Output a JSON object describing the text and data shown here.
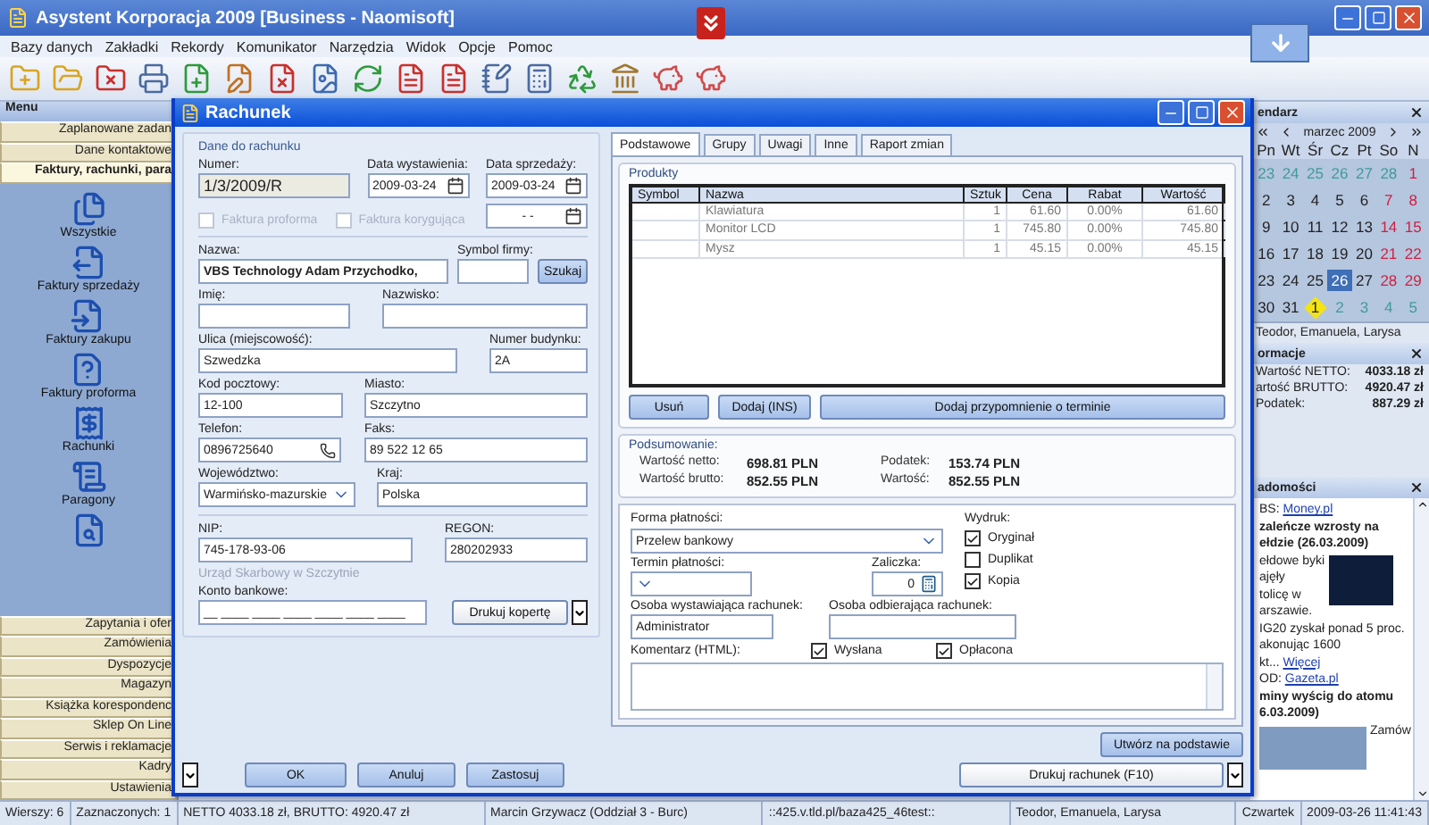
{
  "window": {
    "title": "Asystent Korporacja 2009  [Business - Naomisoft]"
  },
  "menu": [
    "Bazy danych",
    "Zakładki",
    "Rekordy",
    "Komunikator",
    "Narzędzia",
    "Widok",
    "Opcje",
    "Pomoc"
  ],
  "sidebar": {
    "title": "Menu",
    "groups_top": [
      {
        "label": "Zaplanowane zadan",
        "selected": false
      },
      {
        "label": "Dane kontaktowe",
        "selected": false
      },
      {
        "label": "Faktury, rachunki, para",
        "selected": true
      }
    ],
    "items": [
      {
        "label": "Wszystkie"
      },
      {
        "label": "Faktury sprzedaży"
      },
      {
        "label": "Faktury zakupu"
      },
      {
        "label": "Faktury proforma"
      },
      {
        "label": "Rachunki"
      },
      {
        "label": "Paragony"
      }
    ],
    "groups_bottom": [
      {
        "label": "Zapytania i ofer",
        "selected": false
      },
      {
        "label": "Zamówienia",
        "selected": false
      },
      {
        "label": "Dyspozycje",
        "selected": false
      },
      {
        "label": "Magazyn",
        "selected": false
      },
      {
        "label": "Książka korespondenc",
        "selected": false
      },
      {
        "label": "Sklep On Line",
        "selected": false
      },
      {
        "label": "Serwis i reklamacje",
        "selected": false
      },
      {
        "label": "Kadry",
        "selected": false
      },
      {
        "label": "Ustawienia",
        "selected": false
      }
    ]
  },
  "dialog": {
    "title": "Rachunek",
    "section_title": "Dane do rachunku",
    "number_row": [
      {
        "kind": "readonly",
        "label": "Numer:",
        "value": "1/3/2009/R"
      },
      {
        "kind": "date",
        "label": "Data wystawienia:",
        "value": "2009-03-24"
      },
      {
        "kind": "date",
        "label": "Data sprzedaży:",
        "value": "2009-03-24"
      }
    ],
    "doc_checks": [
      {
        "label": "Faktura proforma",
        "checked": false,
        "disabled": true
      },
      {
        "label": "Faktura korygująca",
        "checked": false,
        "disabled": true
      }
    ],
    "second_date": {
      "value": "- -"
    },
    "customer_rows": [
      [
        {
          "kind": "text",
          "label": "Nazwa:",
          "value": "VBS Technology Adam Przychodko,"
        },
        {
          "kind": "text",
          "label": "Symbol firmy:"
        },
        {
          "kind": "button",
          "label": "Szukaj"
        }
      ],
      [
        {
          "kind": "text",
          "label": "Imię:"
        },
        {
          "kind": "text",
          "label": "Nazwisko:"
        }
      ],
      [
        {
          "kind": "text",
          "label": "Ulica (miejscowość):",
          "value": "Szwedzka"
        },
        {
          "kind": "text",
          "label": "Numer budynku:",
          "value": "2A"
        }
      ],
      [
        {
          "kind": "text",
          "label": "Kod pocztowy:",
          "value": "12-100"
        },
        {
          "kind": "text",
          "label": "Miasto:",
          "value": "Szczytno"
        }
      ],
      [
        {
          "kind": "phone",
          "label": "Telefon:",
          "value": "0896725640"
        },
        {
          "kind": "text",
          "label": "Faks:",
          "value": "89 522 12 65"
        }
      ],
      [
        {
          "kind": "select",
          "label": "Województwo:",
          "value": "Warmińsko-mazurskie"
        },
        {
          "kind": "text",
          "label": "Kraj:",
          "value": "Polska"
        }
      ]
    ],
    "tax_row": [
      {
        "kind": "text",
        "label": "NIP:",
        "value": "745-178-93-06"
      },
      {
        "kind": "text",
        "label": "REGON:",
        "value": "280202933"
      }
    ],
    "tax_office": "Urząd Skarbowy w Szczytnie",
    "bank_row": [
      {
        "kind": "text",
        "label": "Konto bankowe:",
        "value": "__ ____ ____ ____ ____ ____ ____"
      },
      {
        "kind": "split",
        "label": "Drukuj kopertę"
      }
    ],
    "buttons": [
      "OK",
      "Anuluj",
      "Zastosuj"
    ],
    "tabs": [
      {
        "label": "Podstawowe",
        "selected": true
      },
      {
        "label": "Grupy",
        "selected": false
      },
      {
        "label": "Uwagi",
        "selected": false
      },
      {
        "label": "Inne",
        "selected": false
      },
      {
        "label": "Raport zmian",
        "selected": false
      }
    ],
    "products": {
      "title": "Produkty",
      "columns": [
        "Symbol",
        "Nazwa",
        "Sztuk",
        "Cena",
        "Rabat",
        "Wartość"
      ],
      "rows": [
        [
          "",
          "Klawiatura",
          "1",
          "61.60",
          "0.00%",
          "61.60"
        ],
        [
          "",
          "Monitor LCD",
          "1",
          "745.80",
          "0.00%",
          "745.80"
        ],
        [
          "",
          "Mysz",
          "1",
          "45.15",
          "0.00%",
          "45.15"
        ]
      ],
      "buttons": [
        "Usuń",
        "Dodaj (INS)",
        "Dodaj przypomnienie o terminie"
      ]
    },
    "summary": {
      "title": "Podsumowanie:",
      "items": [
        {
          "label": "Wartość netto:",
          "value": "698.81 PLN"
        },
        {
          "label": "Podatek:",
          "value": "153.74 PLN"
        },
        {
          "label": "Wartość brutto:",
          "value": "852.55 PLN"
        },
        {
          "label": "Wartość:",
          "value": "852.55 PLN"
        }
      ]
    },
    "payment": {
      "form": {
        "label": "Forma płatności:",
        "value": "Przelew bankowy"
      },
      "print": {
        "label": "Wydruk:",
        "options": [
          {
            "label": "Oryginał",
            "checked": true
          },
          {
            "label": "Duplikat",
            "checked": false
          },
          {
            "label": "Kopia",
            "checked": true
          }
        ]
      },
      "term": {
        "label": "Termin płatności:"
      },
      "advance": {
        "label": "Zaliczka:",
        "value": "0"
      },
      "issuer": {
        "label": "Osoba wystawiająca rachunek:",
        "value": "Administrator"
      },
      "receiver": {
        "label": "Osoba odbierająca rachunek:"
      },
      "comment": {
        "label": "Komentarz (HTML):"
      },
      "flags": [
        {
          "label": "Wysłana",
          "checked": true
        },
        {
          "label": "Opłacona",
          "checked": true
        }
      ]
    },
    "create_button": "Utwórz na podstawie",
    "print_button": "Drukuj rachunek (F10)"
  },
  "calendar": {
    "title": "endarz",
    "month": "marzec 2009",
    "weekdays": [
      "Pn",
      "Wt",
      "Śr",
      "Cz",
      "Pt",
      "So",
      "N"
    ],
    "weeks": [
      [
        {
          "day": "23",
          "kind": "other",
          "selected": false
        },
        {
          "day": "24",
          "kind": "other",
          "selected": false
        },
        {
          "day": "25",
          "kind": "other",
          "selected": false
        },
        {
          "day": "26",
          "kind": "other",
          "selected": false
        },
        {
          "day": "27",
          "kind": "other",
          "selected": false
        },
        {
          "day": "28",
          "kind": "other",
          "selected": false
        },
        {
          "day": "1",
          "kind": "weekend",
          "selected": false
        }
      ],
      [
        {
          "day": "2",
          "kind": "normal",
          "selected": false
        },
        {
          "day": "3",
          "kind": "normal",
          "selected": false
        },
        {
          "day": "4",
          "kind": "normal",
          "selected": false
        },
        {
          "day": "5",
          "kind": "normal",
          "selected": false
        },
        {
          "day": "6",
          "kind": "normal",
          "selected": false
        },
        {
          "day": "7",
          "kind": "weekend",
          "selected": false
        },
        {
          "day": "8",
          "kind": "weekend",
          "selected": false
        }
      ],
      [
        {
          "day": "9",
          "kind": "normal",
          "selected": false
        },
        {
          "day": "10",
          "kind": "normal",
          "selected": false
        },
        {
          "day": "11",
          "kind": "normal",
          "selected": false
        },
        {
          "day": "12",
          "kind": "normal",
          "selected": false
        },
        {
          "day": "13",
          "kind": "normal",
          "selected": false
        },
        {
          "day": "14",
          "kind": "weekend",
          "selected": false
        },
        {
          "day": "15",
          "kind": "weekend",
          "selected": false
        }
      ],
      [
        {
          "day": "16",
          "kind": "normal",
          "selected": false
        },
        {
          "day": "17",
          "kind": "normal",
          "selected": false
        },
        {
          "day": "18",
          "kind": "normal",
          "selected": false
        },
        {
          "day": "19",
          "kind": "normal",
          "selected": false
        },
        {
          "day": "20",
          "kind": "normal",
          "selected": false
        },
        {
          "day": "21",
          "kind": "weekend",
          "selected": false
        },
        {
          "day": "22",
          "kind": "weekend",
          "selected": false
        }
      ],
      [
        {
          "day": "23",
          "kind": "normal",
          "selected": false
        },
        {
          "day": "24",
          "kind": "normal",
          "selected": false
        },
        {
          "day": "25",
          "kind": "normal",
          "selected": false
        },
        {
          "day": "26",
          "kind": "normal",
          "selected": true
        },
        {
          "day": "27",
          "kind": "normal",
          "selected": false
        },
        {
          "day": "28",
          "kind": "weekend",
          "selected": false
        },
        {
          "day": "29",
          "kind": "weekend",
          "selected": false
        }
      ],
      [
        {
          "day": "30",
          "kind": "normal",
          "selected": false
        },
        {
          "day": "31",
          "kind": "normal",
          "selected": false
        },
        {
          "day": "1",
          "kind": "marked",
          "selected": false
        },
        {
          "day": "2",
          "kind": "other",
          "selected": false
        },
        {
          "day": "3",
          "kind": "other",
          "selected": false
        },
        {
          "day": "4",
          "kind": "other",
          "selected": false
        },
        {
          "day": "5",
          "kind": "other",
          "selected": false
        }
      ]
    ],
    "names": "Teodor, Emanuela, Larysa"
  },
  "info": {
    "title": "ormacje",
    "items": [
      {
        "label": "Wartość NETTO:",
        "value": "4033.18 zł"
      },
      {
        "label": "artość BRUTTO:",
        "value": "4920.47 zł"
      },
      {
        "label": "Podatek:",
        "value": "887.29 zł"
      }
    ]
  },
  "news": {
    "title": "adomości",
    "lines": [
      {
        "kind": "source",
        "prefix": "BS: ",
        "link": "Money.pl"
      },
      {
        "kind": "headline",
        "text": "zaleńcze wzrosty na"
      },
      {
        "kind": "headline",
        "text": "ełdzie (26.03.2009)"
      },
      {
        "kind": "photo_text",
        "text": "ełdowe byki"
      },
      {
        "kind": "photo_text",
        "text": "ajęły"
      },
      {
        "kind": "photo_text",
        "text": "tolicę w"
      },
      {
        "kind": "photo_text",
        "text": "arszawie."
      },
      {
        "kind": "text",
        "text": "IG20 zyskał ponad 5 proc."
      },
      {
        "kind": "text",
        "text": "akonując 1600"
      },
      {
        "kind": "source",
        "prefix": "kt... ",
        "link": "Więcej"
      },
      {
        "kind": "source",
        "prefix": "OD: ",
        "link": "Gazeta.pl"
      },
      {
        "kind": "headline",
        "text": "miny wyścig do atomu"
      },
      {
        "kind": "headline",
        "text": "6.03.2009)"
      }
    ],
    "footer": "Zamów"
  },
  "status_bar": [
    "Wierszy: 6",
    "Zaznaczonych: 1",
    "NETTO  4033.18 zł,   BRUTTO: 4920.47 zł",
    "Marcin Grzywacz (Oddział 3 - Burc)",
    "::425.v.tld.pl/baza425_46test::",
    "Teodor, Emanuela, Larysa",
    "Czwartek",
    "2009-03-26 11:41:43"
  ]
}
